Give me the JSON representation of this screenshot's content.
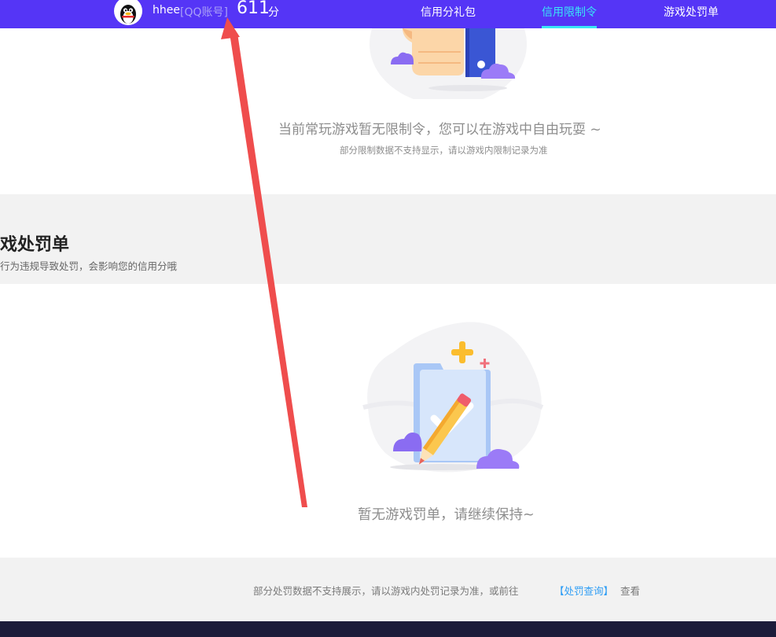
{
  "header": {
    "username": "hhee",
    "account_type": "[QQ账号]",
    "score": "611",
    "score_unit": "分",
    "nav": [
      {
        "label": "信用分礼包",
        "active": false
      },
      {
        "label": "信用限制令",
        "active": true
      },
      {
        "label": "游戏处罚单",
        "active": false
      }
    ]
  },
  "restrictions": {
    "empty_message": "当前常玩游戏暂无限制令，您可以在游戏中自由玩耍 ~",
    "note": "部分限制数据不支持显示，请以游戏内限制记录为准"
  },
  "penalty_section": {
    "title": "戏处罚单",
    "description": "行为违规导致处罚，会影响您的信用分哦",
    "empty_message": "暂无游戏罚单，请继续保持~"
  },
  "footer": {
    "note": "部分处罚数据不支持展示，请以游戏内处罚记录为准，或前往",
    "link": "【处罚查询】",
    "tail": "查看"
  },
  "icons": {
    "avatar": "qq-penguin-icon",
    "top_illustration": "thumbs-up-phone-icon",
    "bottom_illustration": "folder-check-pencil-icon"
  },
  "colors": {
    "topbar": "#5535f6",
    "active_nav": "#39e6f6",
    "link": "#2d9df5",
    "annotation_arrow": "#ef4d4d",
    "grey_band": "#f2f2f2",
    "dark_footer": "#1c1c3a"
  }
}
